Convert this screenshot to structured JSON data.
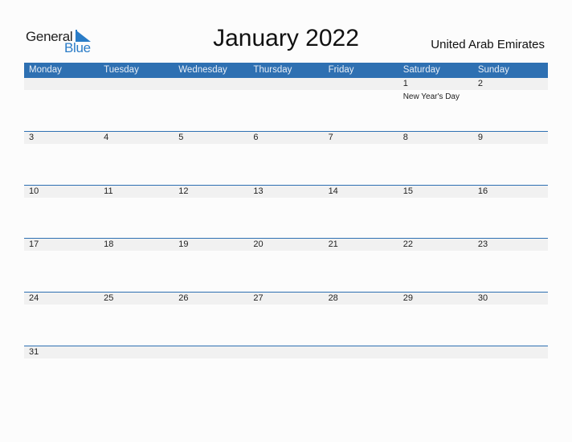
{
  "logo": {
    "general": "General",
    "blue": "Blue",
    "brand_color": "#2a7cc7"
  },
  "title": "January 2022",
  "country": "United Arab Emirates",
  "header_color": "#2e70b2",
  "days": [
    "Monday",
    "Tuesday",
    "Wednesday",
    "Thursday",
    "Friday",
    "Saturday",
    "Sunday"
  ],
  "weeks": [
    [
      {
        "day": ""
      },
      {
        "day": ""
      },
      {
        "day": ""
      },
      {
        "day": ""
      },
      {
        "day": ""
      },
      {
        "day": "1",
        "event": "New Year's Day"
      },
      {
        "day": "2"
      }
    ],
    [
      {
        "day": "3"
      },
      {
        "day": "4"
      },
      {
        "day": "5"
      },
      {
        "day": "6"
      },
      {
        "day": "7"
      },
      {
        "day": "8"
      },
      {
        "day": "9"
      }
    ],
    [
      {
        "day": "10"
      },
      {
        "day": "11"
      },
      {
        "day": "12"
      },
      {
        "day": "13"
      },
      {
        "day": "14"
      },
      {
        "day": "15"
      },
      {
        "day": "16"
      }
    ],
    [
      {
        "day": "17"
      },
      {
        "day": "18"
      },
      {
        "day": "19"
      },
      {
        "day": "20"
      },
      {
        "day": "21"
      },
      {
        "day": "22"
      },
      {
        "day": "23"
      }
    ],
    [
      {
        "day": "24"
      },
      {
        "day": "25"
      },
      {
        "day": "26"
      },
      {
        "day": "27"
      },
      {
        "day": "28"
      },
      {
        "day": "29"
      },
      {
        "day": "30"
      }
    ],
    [
      {
        "day": "31"
      },
      {
        "day": ""
      },
      {
        "day": ""
      },
      {
        "day": ""
      },
      {
        "day": ""
      },
      {
        "day": ""
      },
      {
        "day": ""
      }
    ]
  ]
}
